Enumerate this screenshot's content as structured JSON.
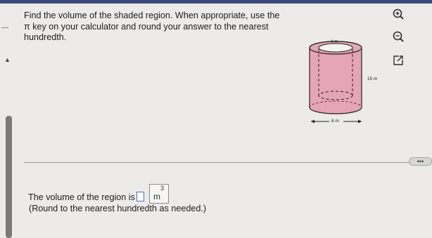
{
  "question": {
    "line1": "Find the volume of the shaded region. When appropriate, use the",
    "line2": "π key on your calculator and round your answer to the nearest",
    "line3": "hundredth."
  },
  "figure": {
    "top_label": "←4 m→",
    "height_label": "15 m",
    "bottom_label": "6 m",
    "shade_color": "#e6a4b9"
  },
  "answer": {
    "prefix": "The volume of the region is",
    "value": "",
    "unit": "m",
    "unit_exponent": "3",
    "note": "(Round to the nearest hundredth as needed.)"
  },
  "more_button_label": "•••"
}
